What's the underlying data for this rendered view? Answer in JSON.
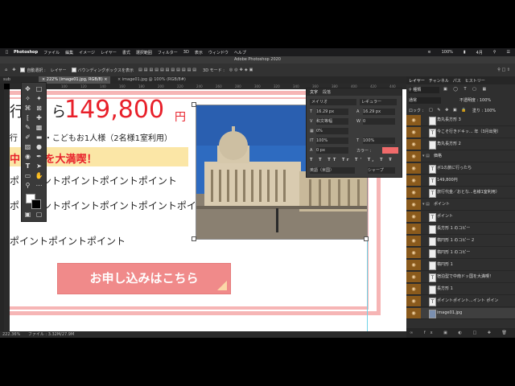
{
  "mac_menu": {
    "app": "Photoshop",
    "items": [
      "ファイル",
      "編集",
      "イメージ",
      "レイヤー",
      "書式",
      "選択範囲",
      "フィルター",
      "3D",
      "表示",
      "ウィンドウ",
      "ヘルプ"
    ],
    "battery": "100%",
    "date": "4月"
  },
  "window_title": "Adobe Photoshop 2020",
  "options_bar": {
    "auto_select": "自動選択 :",
    "layer_dropdown": "レイヤー",
    "bounding_box": "バウンディングボックスを表示",
    "mode_3d": "3D モード :"
  },
  "tabs": [
    {
      "label": "sub"
    },
    {
      "label": "222% (image01.jpg, RGB/8)"
    },
    {
      "label": "image01.jpg @ 100% (RGB/8#)"
    }
  ],
  "ruler_marks": [
    "60",
    "80",
    "100",
    "120",
    "140",
    "160",
    "180",
    "200",
    "220",
    "240",
    "260",
    "280",
    "300",
    "320",
    "340",
    "360",
    "380",
    "400",
    "420",
    "440"
  ],
  "canvas": {
    "price_prefix": "行",
    "price_suffix": "ら",
    "price": "149,800",
    "yen": "円",
    "price_note": "行 おとな・こどもお1人様（2名様1室利用）",
    "highlight": "中 の国を大満喫！",
    "point_line_1": "ポ ポイントポイントポイントポイント",
    "point_line_2": "ポ ポイントポイントポイントポイントポイ",
    "point_line_3": "ポイントポイントポイント",
    "apply_button": "お申し込みはこちら"
  },
  "status_bar": {
    "zoom": "222.36%",
    "file_info": "ファイル : 3.32M/27.9M"
  },
  "char_panel": {
    "tab1": "文字",
    "tab2": "段落",
    "font_family": "メイリオ",
    "font_style": "レギュラー",
    "font_size": "16.29 px",
    "leading": "16.29 px",
    "kerning": "和文等幅",
    "tracking": "0",
    "tsume": "0%",
    "vscale": "100%",
    "hscale": "100%",
    "baseline": "0 px",
    "color_label": "カラー :",
    "language": "英語（米国）",
    "aa": "シャープ"
  },
  "layers_panel": {
    "tabs": [
      "レイヤー",
      "チャンネル",
      "パス",
      "ヒストリー"
    ],
    "kind": "種類",
    "blend": "通常",
    "opacity": "不透明度 : 100%",
    "lock": "ロック :",
    "fill": "塗り : 100%",
    "layers": [
      {
        "name": "角丸長方形 3",
        "type": "shape"
      },
      {
        "name": "今こそ行きドキッ... 年（3月出発）",
        "type": "text"
      },
      {
        "name": "角丸長方形 2",
        "type": "shape"
      },
      {
        "name": "価格",
        "type": "group"
      },
      {
        "name": "ボ1の旅に行ったち",
        "type": "text"
      },
      {
        "name": "149,800円",
        "type": "text"
      },
      {
        "name": "旅行代金／おとな...名様1室利用）",
        "type": "text"
      },
      {
        "name": "ポイント",
        "type": "group"
      },
      {
        "name": "ポイント",
        "type": "text"
      },
      {
        "name": "長方形 1 のコピー",
        "type": "shape"
      },
      {
        "name": "楕円形 1 のコピー 2",
        "type": "shape"
      },
      {
        "name": "楕円形 1 のコピー",
        "type": "shape"
      },
      {
        "name": "楕円形 1",
        "type": "shape"
      },
      {
        "name": "宿泊型で中南ドッ国を大満喫！",
        "type": "text"
      },
      {
        "name": "長方形 1",
        "type": "shape"
      },
      {
        "name": "ポイントポイント...イント ポイン",
        "type": "text"
      },
      {
        "name": "image01.jpg",
        "type": "image"
      }
    ]
  },
  "colors": {
    "price_red": "#e8202a",
    "button_pink": "#f08a8a",
    "highlight_yellow": "#fbe6a6",
    "frame_pink": "#f6b5b5",
    "layer_eye": "#8a5a1c"
  }
}
